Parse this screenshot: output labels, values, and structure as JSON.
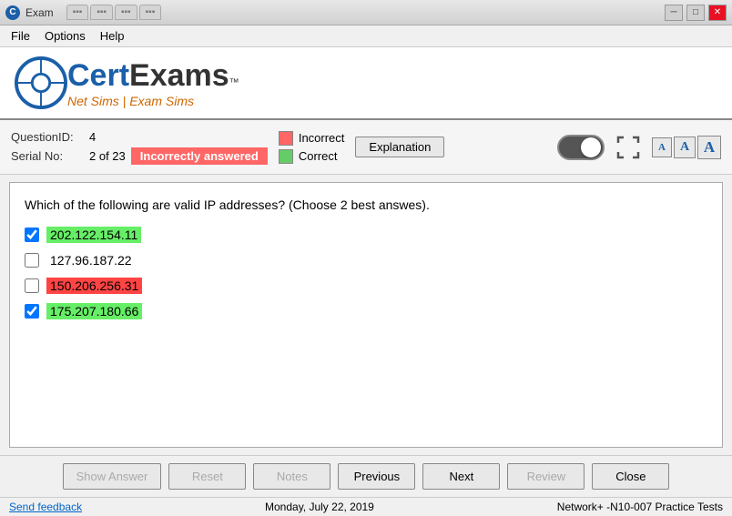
{
  "titlebar": {
    "icon": "C",
    "title": "Exam",
    "tabs": [
      "",
      "",
      "",
      "",
      ""
    ],
    "minimize": "─",
    "maximize": "□",
    "close": "✕"
  },
  "menu": {
    "file": "File",
    "options": "Options",
    "help": "Help"
  },
  "logo": {
    "cert": "Cert",
    "exams": "Exams",
    "tm": "™",
    "tagline": "Net Sims | Exam Sims"
  },
  "infobar": {
    "question_id_label": "QuestionID:",
    "question_id_value": "4",
    "serial_label": "Serial No:",
    "serial_value": "2 of 23",
    "incorrect_badge": "Incorrectly answered",
    "incorrect_color_label": "Incorrect",
    "correct_color_label": "Correct",
    "explanation_btn": "Explanation"
  },
  "question": {
    "text": "Which of the following are valid IP addresses? (Choose 2 best answes).",
    "options": [
      {
        "id": "opt1",
        "label": "202.122.154.11",
        "checked": true,
        "style": "highlight-green"
      },
      {
        "id": "opt2",
        "label": "127.96.187.22",
        "checked": false,
        "style": ""
      },
      {
        "id": "opt3",
        "label": "150.206.256.31",
        "checked": false,
        "style": "highlight-red"
      },
      {
        "id": "opt4",
        "label": "175.207.180.66",
        "checked": true,
        "style": "highlight-green"
      }
    ]
  },
  "buttons": {
    "show_answer": "Show Answer",
    "reset": "Reset",
    "notes": "Notes",
    "previous": "Previous",
    "next": "Next",
    "review": "Review",
    "close": "Close"
  },
  "statusbar": {
    "feedback": "Send feedback",
    "date": "Monday, July 22, 2019",
    "product": "Network+ -N10-007 Practice Tests"
  }
}
